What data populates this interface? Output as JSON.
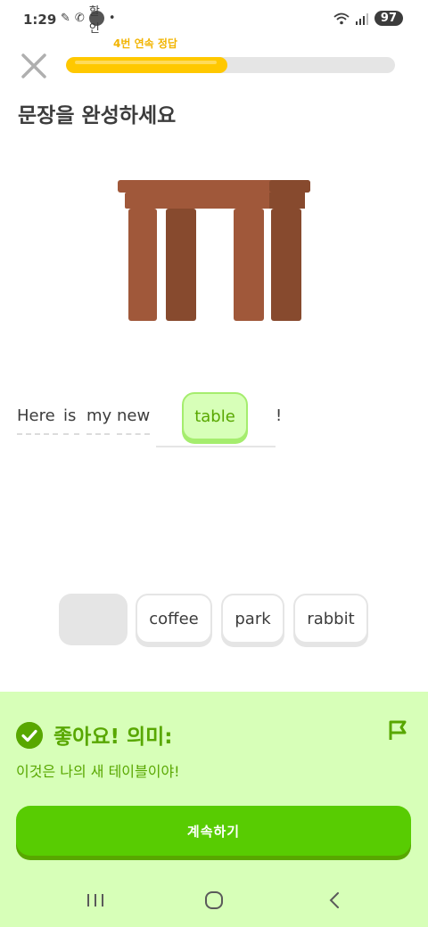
{
  "status_bar": {
    "time": "1:29",
    "app_badge": "할인",
    "battery": "97"
  },
  "header": {
    "streak_label": "4번 연속 정답",
    "progress_fraction": 0.49
  },
  "title": "문장을 완성하세요",
  "illustration": {
    "name": "table-illustration",
    "colors": {
      "primary": "#a0583a",
      "shadow": "#874a2e"
    }
  },
  "sentence": {
    "words": [
      "Here",
      "is",
      "my",
      "new"
    ],
    "answer": "table",
    "punctuation": "!"
  },
  "word_bank": {
    "items": [
      "coffee",
      "park",
      "rabbit"
    ]
  },
  "feedback": {
    "title": "좋아요! 의미:",
    "translation": "이것은 나의 새 테이블이야!",
    "continue_label": "계속하기"
  },
  "colors": {
    "accent_green": "#58cc02",
    "feedback_bg": "#d7ffb8",
    "feedback_text": "#58a700",
    "progress_yellow": "#ffc800",
    "streak_text": "#f2b400"
  }
}
